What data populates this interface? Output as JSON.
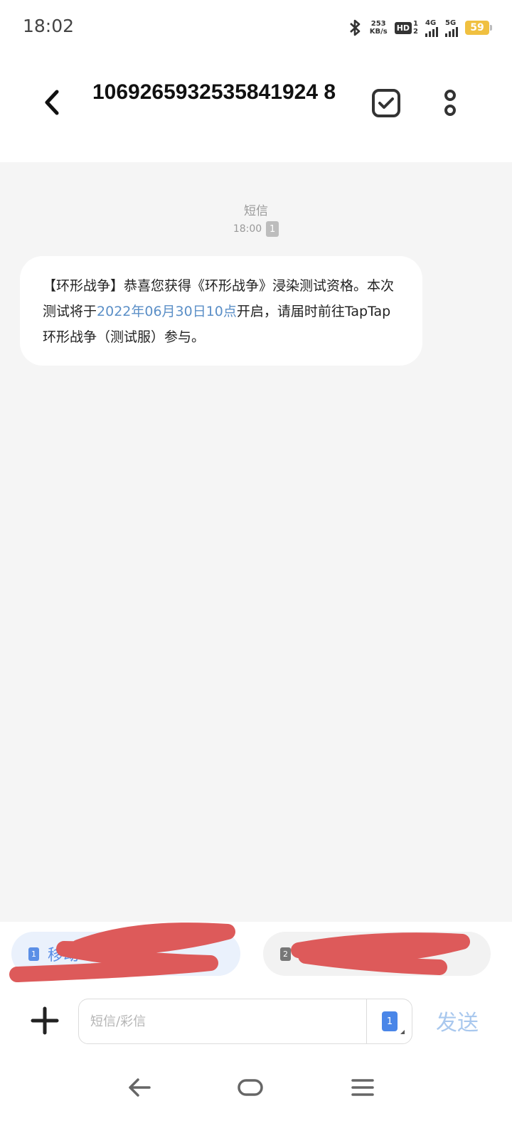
{
  "status_bar": {
    "time": "18:02",
    "speed_value": "253",
    "speed_unit": "KB/s",
    "hd_label": "HD",
    "hd_sim_1": "1",
    "hd_sim_2": "2",
    "signal_1_label": "4G",
    "signal_2_label": "5G",
    "battery_level": "59",
    "battery_color": "#f0c040",
    "icons": [
      "bluetooth-icon",
      "hd-icon",
      "signal-4g-icon",
      "signal-5g-icon",
      "battery-icon"
    ]
  },
  "header": {
    "contact_number": "1069265932535841924 8",
    "back_icon": "chevron-left-icon",
    "select_icon": "checkbox-icon",
    "more_icon": "more-vertical-icon"
  },
  "conversation": {
    "message_type": "短信",
    "time": "18:00",
    "sim_slot": "1",
    "message": {
      "part1": "【环形战争】恭喜您获得《环形战争》浸染测试资格。本次测试将于",
      "link": "2022年06月30日10点",
      "part2": "开启，请届时前往TapTap环形战争（测试服）参与。"
    },
    "link_color": "#5b8fc7"
  },
  "sim_selector": {
    "sim1_number": "1",
    "sim1_name": "移动",
    "sim2_number": "2",
    "sim2_name": ""
  },
  "composer": {
    "placeholder": "短信/彩信",
    "sim_slot": "1",
    "send_label": "发送",
    "add_icon": "plus-icon"
  },
  "nav_bar": {
    "icons": [
      "back-arrow-icon",
      "home-icon",
      "menu-icon"
    ]
  }
}
